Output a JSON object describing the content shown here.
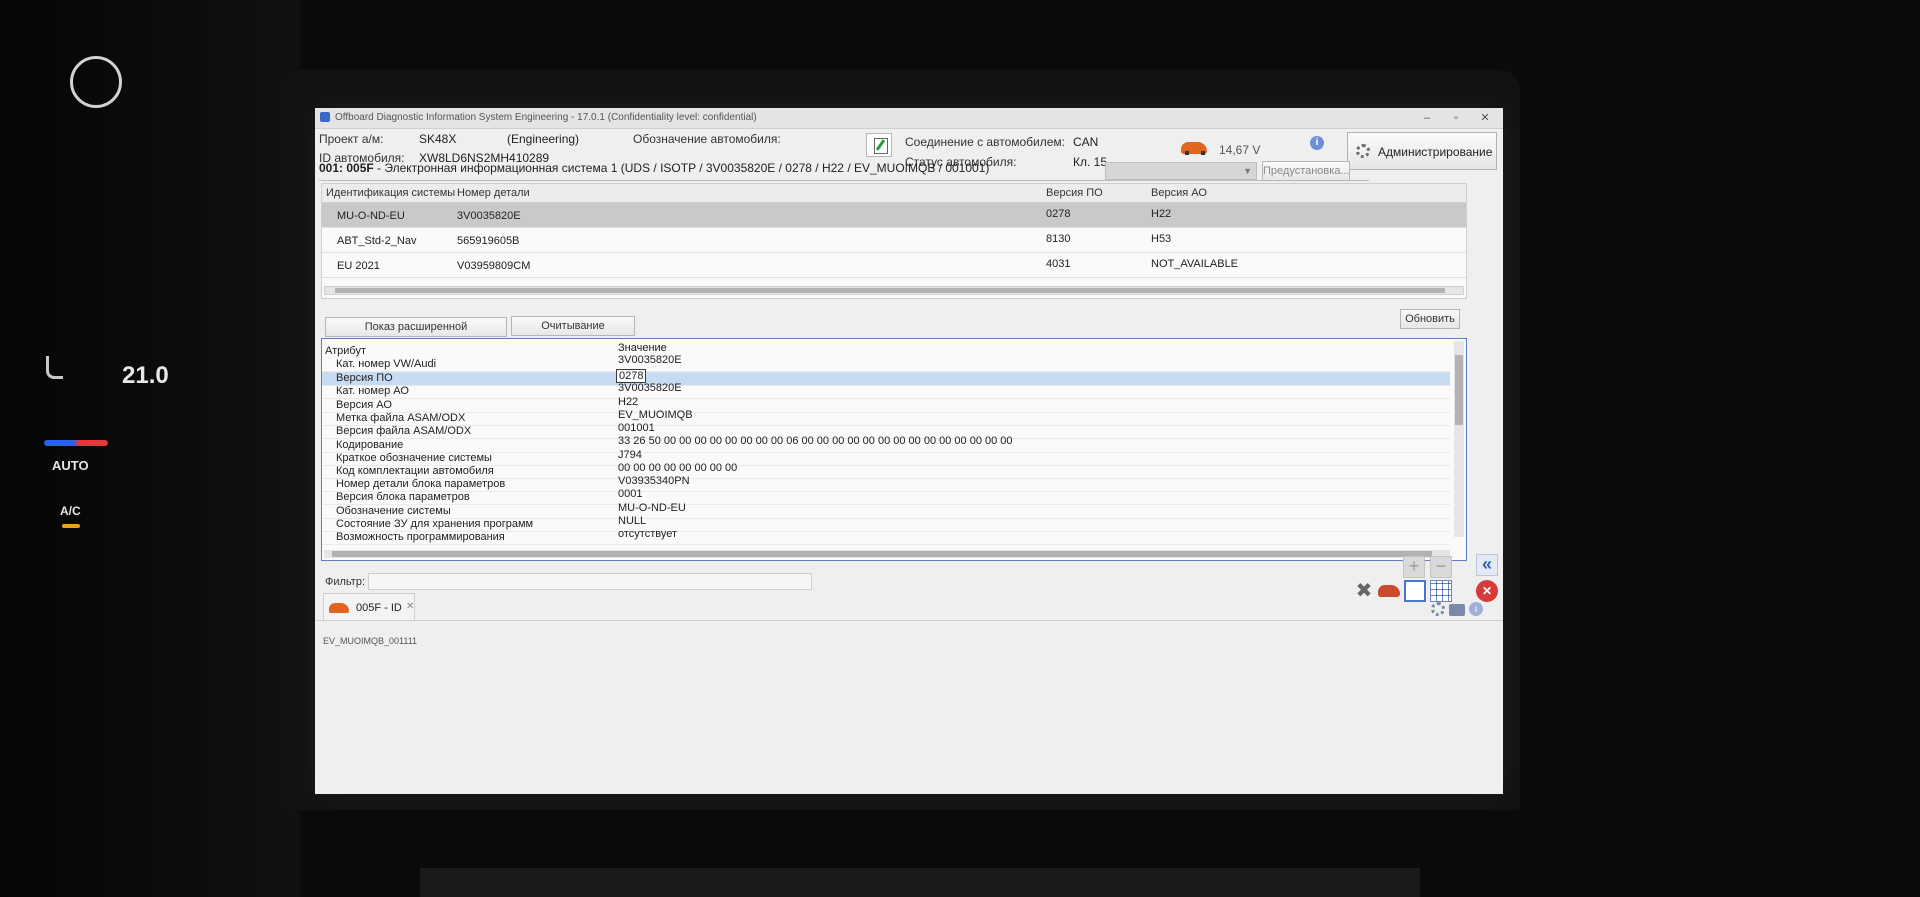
{
  "window": {
    "title": "Offboard Diagnostic Information System Engineering - 17.0.1 (Confidentiality level: confidential)",
    "minimize": "–",
    "maximize": "▫",
    "close": "✕"
  },
  "header": {
    "project_label": "Проект а/м:",
    "project_value": "SK48X",
    "project_mode": "(Engineering)",
    "vin_label": "ID автомобиля:",
    "vin_value": "XW8LD6NS2MH410289",
    "designation_label": "Обозначение автомобиля:",
    "connection_label": "Соединение с автомобилем:",
    "connection_value": "CAN",
    "status_label": "Статус автомобиля:",
    "status_value": "Кл. 15",
    "voltage": "14,67 V",
    "admin_button": "Администрирование"
  },
  "ecu": {
    "id": "001: 005F",
    "description": " - Электронная информационная система 1  (UDS / ISOTP / 3V0035820E / 0278 / H22 / EV_MUOIMQB / 001001)",
    "preset_button": "Предустановка..."
  },
  "ident_table": {
    "headers": [
      "Идентификация системы",
      "Номер детали",
      "Версия ПО",
      "Версия АО"
    ],
    "rows": [
      [
        "MU-O-ND-EU",
        "3V0035820E",
        "0278",
        "H22"
      ],
      [
        "ABT_Std-2_Nav",
        "565919605B",
        "8130",
        "H53"
      ],
      [
        "EU 2021",
        "V03959809CM",
        "4031",
        "NOT_AVAILABLE"
      ]
    ]
  },
  "actions": {
    "extended_ident": "Показ расширенной идентификации",
    "read_subsystems": "Очитывание подсистемы",
    "refresh": "Обновить"
  },
  "attr_table": {
    "headers": [
      "Атрибут",
      "Значение"
    ],
    "rows": [
      [
        "Кат. номер VW/Audi",
        "3V0035820E"
      ],
      [
        "Версия ПО",
        "0278"
      ],
      [
        "Кат. номер АО",
        "3V0035820E"
      ],
      [
        "Версия АО",
        "H22"
      ],
      [
        "Метка файла ASAM/ODX",
        "EV_MUOIMQB"
      ],
      [
        "Версия файла ASAM/ODX",
        "001001"
      ],
      [
        "Кодирование",
        "33 26 50 00 00 00 00 00 00 00 00 06 00 00 00 00 00 00 00 00 00 00 00 00 00 00"
      ],
      [
        "Краткое обозначение системы",
        "J794"
      ],
      [
        "Код комплектации автомобиля",
        "00 00 00 00 00 00 00 00"
      ],
      [
        "Номер детали блока параметров",
        "V03935340PN"
      ],
      [
        "Версия блока параметров",
        "0001"
      ],
      [
        "Обозначение системы",
        "MU-O-ND-EU"
      ],
      [
        "Состояние ЗУ для хранения программ",
        "NULL"
      ],
      [
        "Возможность программирования",
        "отсутствует"
      ]
    ]
  },
  "filter": {
    "label": "Фильтр:",
    "value": ""
  },
  "tab": {
    "label": "005F - ID",
    "close": "✕"
  },
  "statusbar": {
    "text": "EV_MUOIMQB_001111"
  },
  "dashboard": {
    "temperature": "21.0",
    "auto_label": "AUTO",
    "ac_label": "A/C"
  },
  "colors": {
    "selection_row": "#c7dcf2",
    "accent_orange": "#e0651e",
    "close_red": "#d83a3a",
    "nav_blue": "#2e5fb5"
  }
}
